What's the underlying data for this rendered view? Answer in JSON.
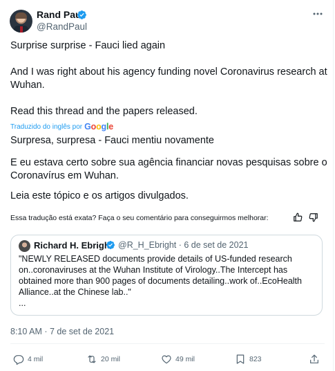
{
  "author": {
    "name": "Rand Paul",
    "handle": "@RandPaul"
  },
  "tweet": {
    "lines": [
      "Surprise surprise - Fauci lied again",
      "And I was right about his agency funding novel Coronavirus research at",
      "Wuhan.",
      "Read this thread and the papers released."
    ],
    "translated_label": "Traduzido do inglês por",
    "google_letters": [
      "G",
      "o",
      "o",
      "g",
      "l",
      "e"
    ],
    "translation_lines": [
      "Surpresa, surpresa - Fauci mentiu novamente",
      "E eu estava certo sobre sua agência financiar novas pesquisas sobre o",
      "Coronavírus em Wuhan.",
      "Leia este tópico e os artigos divulgados."
    ],
    "feedback_prompt": "Essa tradução está exata? Faça o seu comentário para conseguirmos melhorar:"
  },
  "quote": {
    "name": "Richard H. Ebright",
    "meta": "@R_H_Ebright · 6 de set de 2021",
    "lines": [
      "\"NEWLY RELEASED documents provide details of US-funded research",
      "on..coronaviruses at the Wuhan Institute of Virology..The Intercept has",
      "obtained more than 900 pages of documents detailing..work of..EcoHealth",
      "Alliance..at the Chinese lab..\"",
      "..."
    ]
  },
  "timestamp": "8:10 AM · 7 de set de 2021",
  "actions": {
    "replies": "4 mil",
    "retweets": "20 mil",
    "likes": "49 mil",
    "views": "823"
  },
  "colors": {
    "accent": "#1d9bf0",
    "text": "#0f1419",
    "muted": "#536471",
    "border": "#cfd9de"
  },
  "icons": [
    "verified-badge-icon",
    "more-icon",
    "thumbs-up-icon",
    "thumbs-down-icon",
    "reply-icon",
    "retweet-icon",
    "like-icon",
    "views-icon",
    "share-icon"
  ]
}
